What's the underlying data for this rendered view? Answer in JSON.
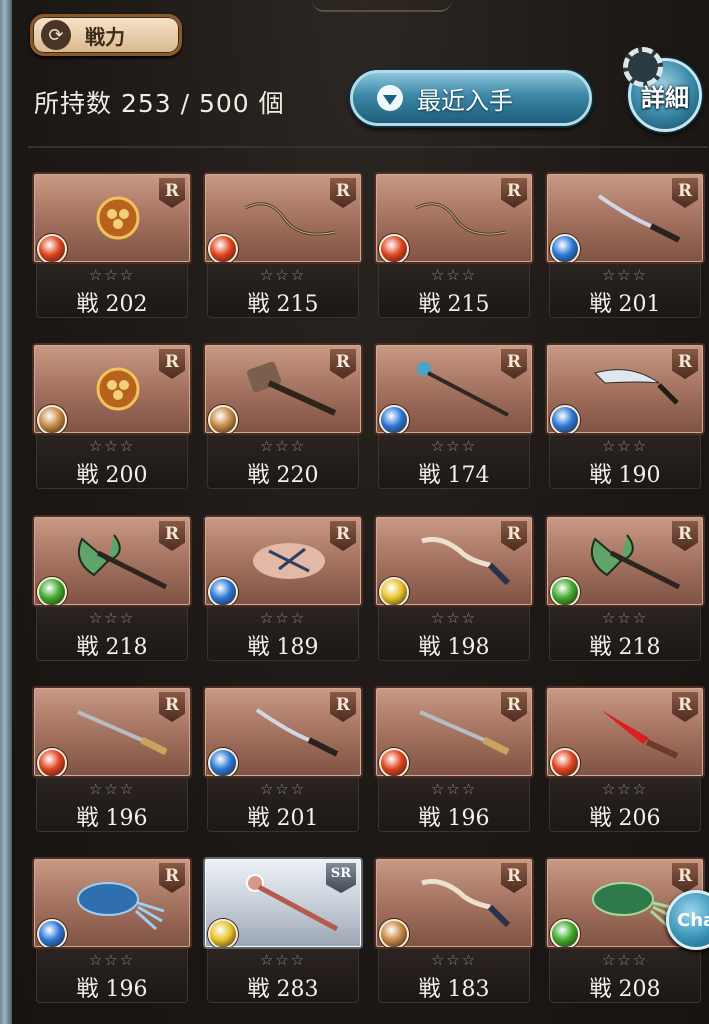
{
  "header": {
    "sort_label": "戦力",
    "sort_icon": "cycle-icon",
    "count_text": "所持数 253 / 500 個",
    "filter_label": "最近入手",
    "detail_label": "詳細",
    "chat_label": "Cha"
  },
  "colors": {
    "fire": "#e0431e",
    "water": "#2a78d8",
    "earth": "#c58a43",
    "wind": "#3faa2e",
    "light": "#e6c42a"
  },
  "weapons": [
    {
      "rarity": "R",
      "element": "fire",
      "weapon": "axe-gold",
      "stars": "☆☆☆",
      "power": "戦 202"
    },
    {
      "rarity": "R",
      "element": "fire",
      "weapon": "bow",
      "stars": "☆☆☆",
      "power": "戦 215"
    },
    {
      "rarity": "R",
      "element": "fire",
      "weapon": "bow",
      "stars": "☆☆☆",
      "power": "戦 215"
    },
    {
      "rarity": "R",
      "element": "water",
      "weapon": "katana",
      "stars": "☆☆☆",
      "power": "戦 201"
    },
    {
      "rarity": "R",
      "element": "earth",
      "weapon": "axe-gold",
      "stars": "☆☆☆",
      "power": "戦 200"
    },
    {
      "rarity": "R",
      "element": "earth",
      "weapon": "hammer",
      "stars": "☆☆☆",
      "power": "戦 220"
    },
    {
      "rarity": "R",
      "element": "water",
      "weapon": "staff",
      "stars": "☆☆☆",
      "power": "戦 174"
    },
    {
      "rarity": "R",
      "element": "water",
      "weapon": "scimitar",
      "stars": "☆☆☆",
      "power": "戦 190"
    },
    {
      "rarity": "R",
      "element": "wind",
      "weapon": "axe-green",
      "stars": "☆☆☆",
      "power": "戦 218"
    },
    {
      "rarity": "R",
      "element": "water",
      "weapon": "fist",
      "stars": "☆☆☆",
      "power": "戦 189"
    },
    {
      "rarity": "R",
      "element": "light",
      "weapon": "kris",
      "stars": "☆☆☆",
      "power": "戦 198"
    },
    {
      "rarity": "R",
      "element": "wind",
      "weapon": "axe-green",
      "stars": "☆☆☆",
      "power": "戦 218"
    },
    {
      "rarity": "R",
      "element": "fire",
      "weapon": "sword",
      "stars": "☆☆☆",
      "power": "戦 196"
    },
    {
      "rarity": "R",
      "element": "water",
      "weapon": "katana",
      "stars": "☆☆☆",
      "power": "戦 201"
    },
    {
      "rarity": "R",
      "element": "fire",
      "weapon": "sword",
      "stars": "☆☆☆",
      "power": "戦 196"
    },
    {
      "rarity": "R",
      "element": "fire",
      "weapon": "dagger-red",
      "stars": "☆☆☆",
      "power": "戦 206"
    },
    {
      "rarity": "R",
      "element": "water",
      "weapon": "gauntlet-blue",
      "stars": "☆☆☆",
      "power": "戦 196"
    },
    {
      "rarity": "SR",
      "element": "light",
      "weapon": "staff-pink",
      "stars": "☆☆☆",
      "power": "戦 283"
    },
    {
      "rarity": "R",
      "element": "earth",
      "weapon": "kris",
      "stars": "☆☆☆",
      "power": "戦 183"
    },
    {
      "rarity": "R",
      "element": "wind",
      "weapon": "gauntlet-green",
      "stars": "☆☆☆",
      "power": "戦 208"
    }
  ]
}
